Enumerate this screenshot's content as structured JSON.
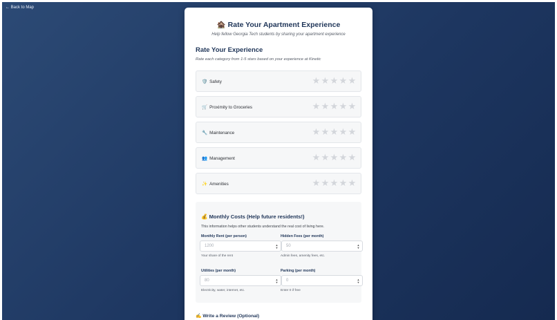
{
  "back_link": "← Back to Map",
  "header": {
    "title": "🏚️ Rate Your Apartment Experience",
    "subtitle": "Help fellow Georgia Tech students by sharing your apartment experience"
  },
  "rating_section": {
    "title": "Rate Your Experience",
    "subtitle": "Rate each category from 1-5 stars based on your experience at Kinetic",
    "star_glyph": "★",
    "star_empty_color": "#d3d6db",
    "categories": [
      {
        "icon": "shield-icon",
        "emoji": "🛡️",
        "label": "Safety",
        "rating": 0
      },
      {
        "icon": "cart-icon",
        "emoji": "🛒",
        "label": "Proximity to Groceries",
        "rating": 0
      },
      {
        "icon": "wrench-icon",
        "emoji": "🔧",
        "label": "Maintenance",
        "rating": 0
      },
      {
        "icon": "people-icon",
        "emoji": "👥",
        "label": "Management",
        "rating": 0
      },
      {
        "icon": "sparkle-icon",
        "emoji": "✨",
        "label": "Amenities",
        "rating": 0
      }
    ]
  },
  "costs": {
    "title": "💰 Monthly Costs (Help future residents!)",
    "description": "This information helps other students understand the real cost of living here.",
    "fields": {
      "rent": {
        "label": "Monthly Rent (per person)",
        "placeholder": "1200",
        "help": "Your share of the rent"
      },
      "hidden_fees": {
        "label": "Hidden Fees (per month)",
        "placeholder": "50",
        "help": "Admin fees, amenity fees, etc."
      },
      "utilities": {
        "label": "Utilities (per month)",
        "placeholder": "80",
        "help": "Electricity, water, internet, etc."
      },
      "parking": {
        "label": "Parking (per month)",
        "placeholder": "0",
        "help": "Enter 0 if free"
      }
    }
  },
  "review": {
    "title": "✍️ Write a Review (Optional)"
  },
  "colors": {
    "primary": "#1f3558",
    "background_start": "#2c4a75",
    "background_end": "#152a50",
    "card": "#ffffff",
    "row_bg": "#f6f7f8"
  }
}
